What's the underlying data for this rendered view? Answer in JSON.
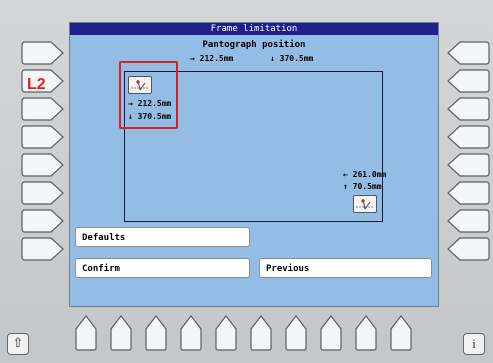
{
  "screen": {
    "title": "Frame limitation",
    "subtitle": "Pantograph position",
    "current_x": "→ 212.5mm",
    "current_y": "↓ 370.5mm"
  },
  "frame": {
    "top_left": {
      "icon": "pantograph-icon",
      "x": "→ 212.5mm",
      "y": "↓ 370.5mm"
    },
    "bottom_right": {
      "icon": "pantograph-icon",
      "x": "← 261.0mm",
      "y": "↑ 70.5mm"
    }
  },
  "buttons": {
    "defaults": "Defaults",
    "confirm": "Confirm",
    "previous": "Previous"
  },
  "annotation": {
    "label": "L2",
    "color": "#e02020"
  },
  "hardware": {
    "home_icon": "home-icon",
    "info_label": "i"
  },
  "colors": {
    "screen_bg": "#94bde6",
    "title_bar": "#20208c",
    "highlight": "#d42222"
  }
}
